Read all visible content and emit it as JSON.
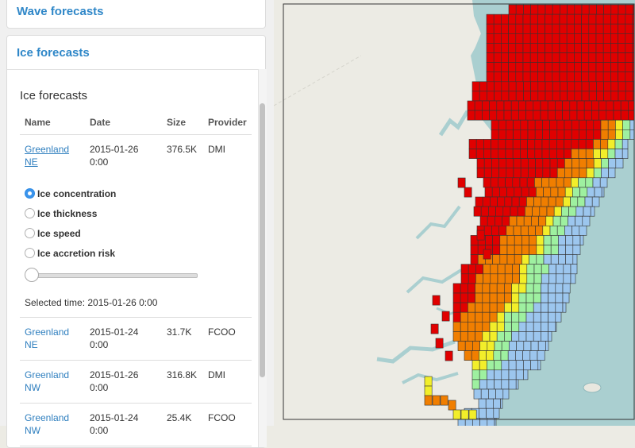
{
  "sidebar": {
    "wave_title": "Wave forecasts",
    "ice_title": "Ice forecasts",
    "ice_heading": "Ice forecasts",
    "columns": [
      "Name",
      "Date",
      "Size",
      "Provider"
    ],
    "rows": [
      {
        "name_line1": "Greenland",
        "name_line2": "NE",
        "date_line1": "2015-01-26",
        "date_line2": "0:00",
        "size": "376.5K",
        "provider": "DMI"
      },
      {
        "name_line1": "Greenland",
        "name_line2": "NE",
        "date_line1": "2015-01-24",
        "date_line2": "0:00",
        "size": "31.7K",
        "provider": "FCOO"
      },
      {
        "name_line1": "Greenland",
        "name_line2": "NW",
        "date_line1": "2015-01-26",
        "date_line2": "0:00",
        "size": "316.8K",
        "provider": "DMI"
      },
      {
        "name_line1": "Greenland",
        "name_line2": "NW",
        "date_line1": "2015-01-24",
        "date_line2": "0:00",
        "size": "25.4K",
        "provider": "FCOO"
      }
    ],
    "options": [
      {
        "label": "Ice concentration",
        "selected": true
      },
      {
        "label": "Ice thickness",
        "selected": false
      },
      {
        "label": "Ice speed",
        "selected": false
      },
      {
        "label": "Ice accretion risk",
        "selected": false
      }
    ],
    "slider_position": 0,
    "selected_time": "Selected time: 2015-01-26 0:00"
  },
  "map": {
    "colors": {
      "land": "#ecebe4",
      "sea": "#aacfd0",
      "high": "#e00000",
      "orange": "#f07e00",
      "yellow": "#f2ee2a",
      "green": "#9ef0a0",
      "blue": "#9cc6ee"
    }
  }
}
